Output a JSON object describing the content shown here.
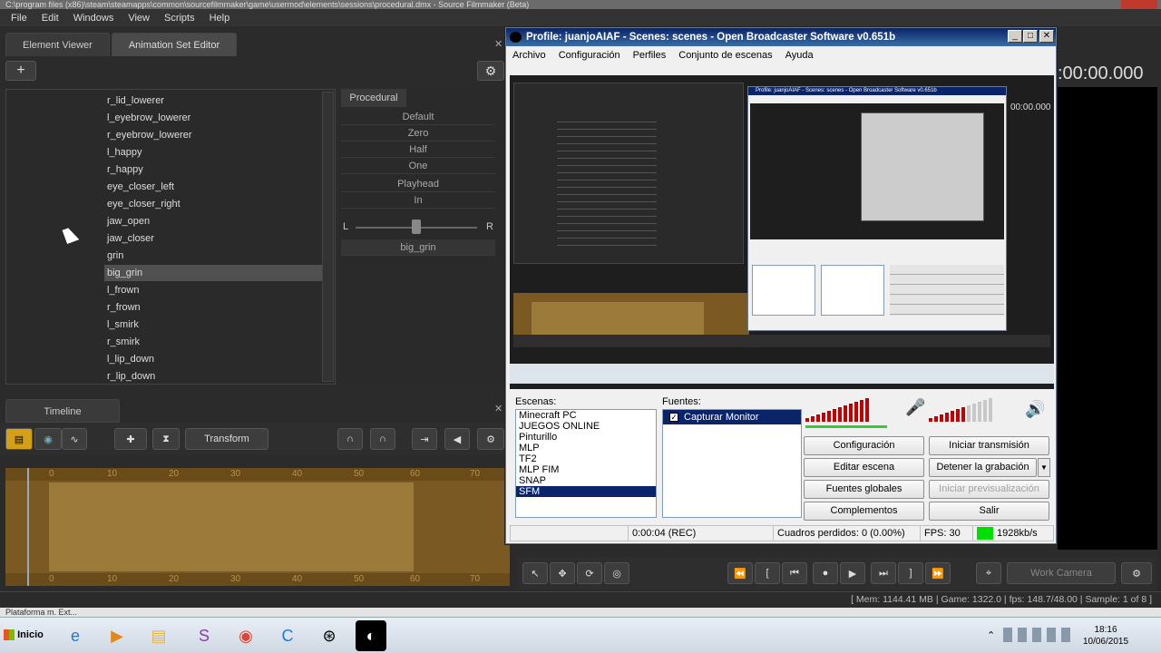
{
  "sfm": {
    "window_title": "C:\\program files (x86)\\steam\\steamapps\\common\\sourcefilmmaker\\game\\usermod\\elements\\sessions\\procedural.dmx - Source Filmmaker (Beta)",
    "menu": [
      "File",
      "Edit",
      "Windows",
      "View",
      "Scripts",
      "Help"
    ],
    "tabs": [
      "Element Viewer",
      "Animation Set Editor"
    ],
    "controls": [
      "r_lid_lowerer",
      "l_eyebrow_lowerer",
      "r_eyebrow_lowerer",
      "l_happy",
      "r_happy",
      "eye_closer_left",
      "eye_closer_right",
      "jaw_open",
      "jaw_closer",
      "grin",
      "big_grin",
      "l_frown",
      "r_frown",
      "l_smirk",
      "r_smirk",
      "l_lip_down",
      "r_lip_down"
    ],
    "selected_control": "big_grin",
    "procedural": {
      "tab": "Procedural",
      "presets": [
        "Default",
        "Zero",
        "Half",
        "One",
        "Playhead",
        "In"
      ],
      "slider_left": "L",
      "slider_right": "R",
      "selected_label": "big_grin"
    },
    "timecode": ":00:00.000",
    "preview_timecode_inner": "00:00.000",
    "timeline": {
      "tab": "Timeline",
      "transform_label": "Transform",
      "ruler_ticks": [
        "0",
        "10",
        "20",
        "30",
        "40",
        "50",
        "60",
        "70"
      ]
    },
    "viewport": {
      "camera": "Work Camera"
    },
    "statusbar": "[ Mem:   1144.41 MB | Game:   1322.0 | fps:  148.7/48.00 | Sample:          1 of 8 ]"
  },
  "obs": {
    "title": "Profile: juanjoAIAF - Scenes: scenes - Open Broadcaster Software v0.651b",
    "menu": [
      "Archivo",
      "Configuración",
      "Perfiles",
      "Conjunto de escenas",
      "Ayuda"
    ],
    "scenes_label": "Escenas:",
    "scenes": [
      "Minecraft PC",
      "JUEGOS ONLINE",
      "Pinturillo",
      "MLP",
      "TF2",
      "MLP FIM",
      "SNAP",
      "SFM"
    ],
    "selected_scene": "SFM",
    "sources_label": "Fuentes:",
    "sources": [
      "Capturar Monitor"
    ],
    "buttons": {
      "config": "Configuración",
      "start_stream": "Iniciar transmisión",
      "edit_scene": "Editar escena",
      "stop_record": "Detener la grabación",
      "global_sources": "Fuentes globales",
      "start_preview": "Iniciar previsualización",
      "plugins": "Complementos",
      "exit": "Salir"
    },
    "status": {
      "time": "0:00:04 (REC)",
      "dropped": "Cuadros perdidos: 0 (0.00%)",
      "fps": "FPS: 30",
      "bitrate": "1928kb/s"
    },
    "nested_title": "Profile: juanjoAIAF - Scenes: scenes - Open Broadcaster Software v0.651b"
  },
  "taskbar": {
    "start": "Inicio",
    "partial_window": "Plataforma m. Ext...",
    "time": "18:16",
    "date": "10/06/2015"
  },
  "colors": {
    "sfm_bg": "#2b2b2b",
    "timeline_brown": "#9c7a3a",
    "obs_title": "#0a246a",
    "meter_red": "#c00000",
    "bitrate_green": "#00e000"
  }
}
